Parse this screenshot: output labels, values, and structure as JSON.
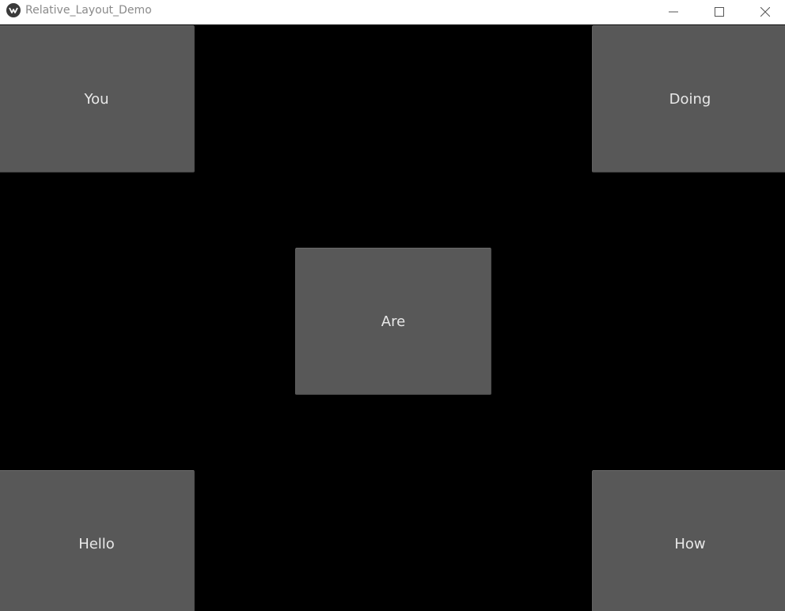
{
  "window": {
    "title": "Relative_Layout_Demo",
    "controls": {
      "minimize_icon": "minimize-icon",
      "maximize_icon": "maximize-icon",
      "close_icon": "close-icon"
    }
  },
  "layout": {
    "background_color": "#000000",
    "button_color": "#585858",
    "buttons": {
      "top_left": "You",
      "top_right": "Doing",
      "center": "Are",
      "bottom_left": "Hello",
      "bottom_right": "How"
    }
  }
}
